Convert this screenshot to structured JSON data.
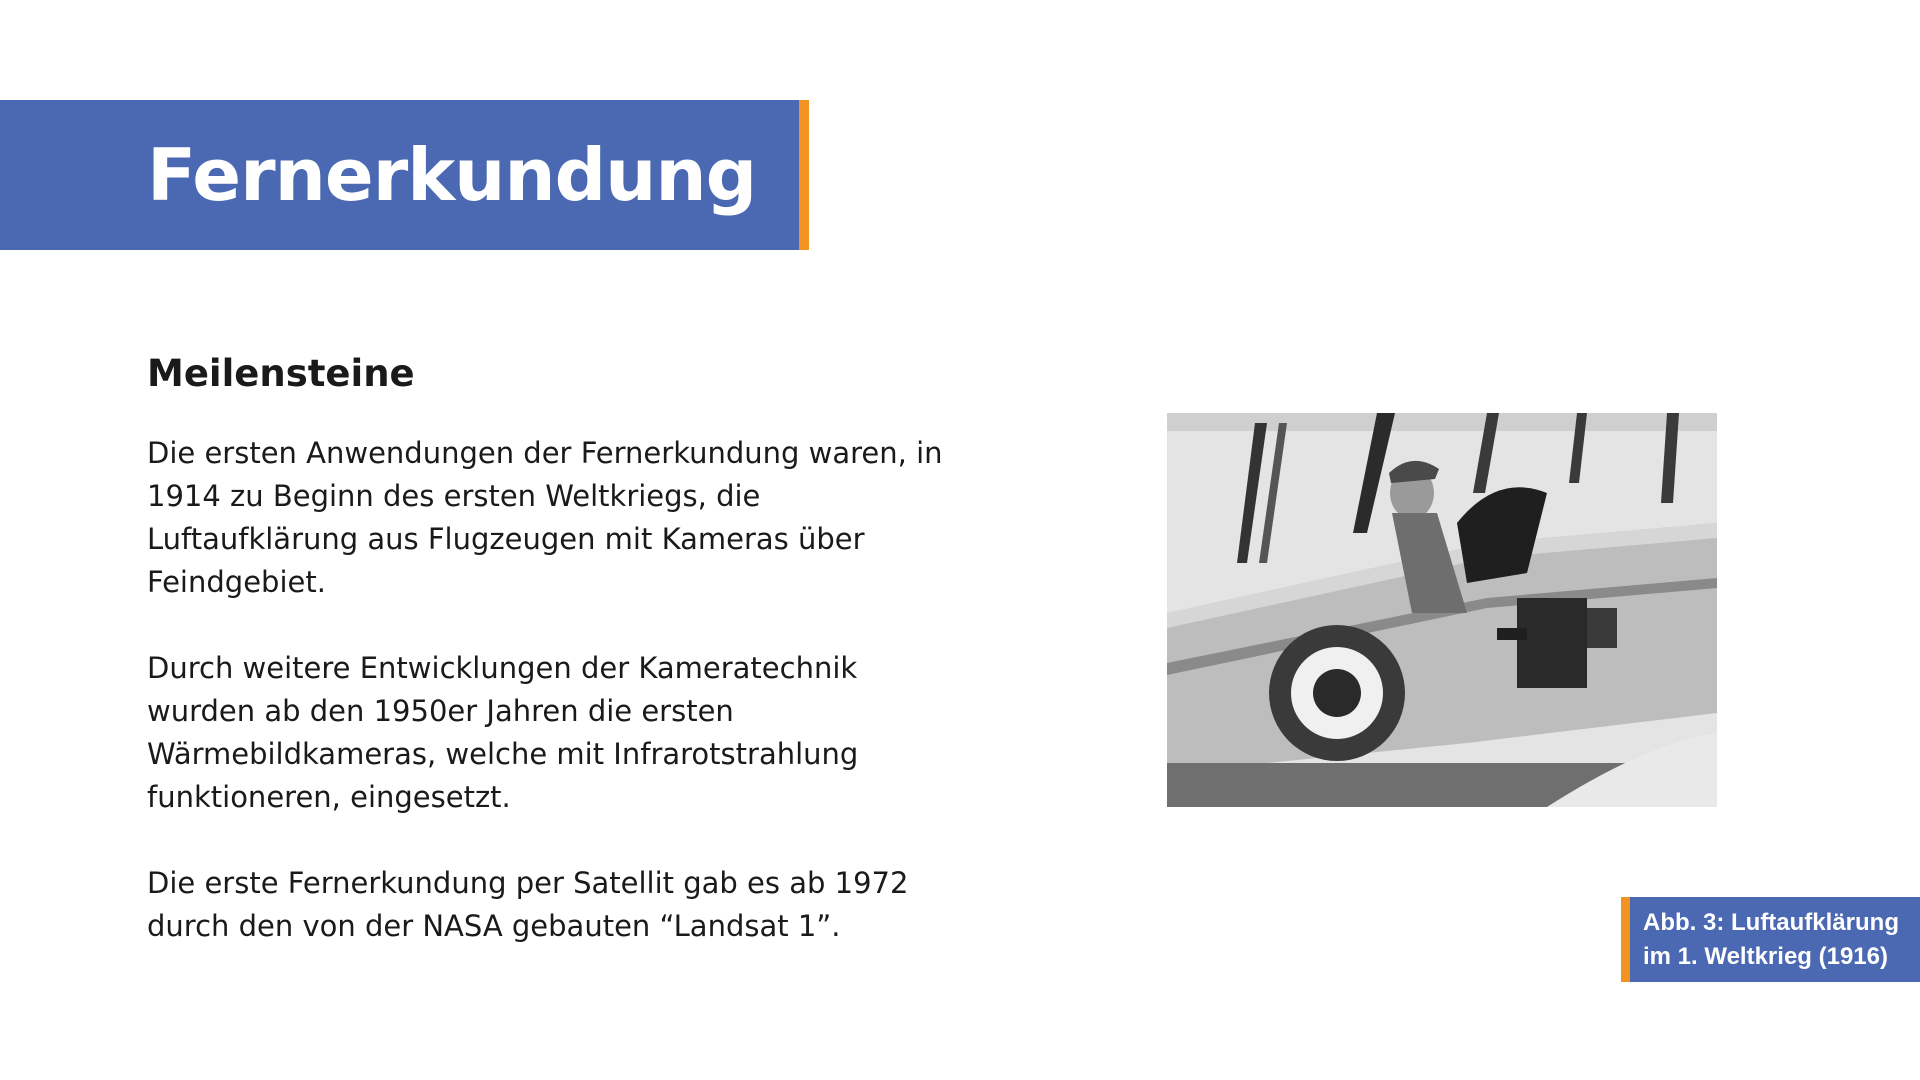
{
  "slide": {
    "title": "Fernerkundung",
    "subheading": "Meilensteine",
    "paragraphs": [
      "Die ersten Anwendungen der Fernerkundung waren, in 1914 zu Beginn des ersten Weltkriegs, die Luftaufklärung aus Flugzeugen mit Kameras über Feindgebiet.",
      "Durch weitere Entwicklungen der Kameratechnik wurden ab den 1950er Jahren die ersten Wärmebildkameras, welche mit Infrarotstrahlung funktioneren, eingesetzt.",
      "Die erste Fernerkundung per Satellit gab es ab 1972 durch den von der NASA gebauten “Landsat 1”."
    ],
    "caption": {
      "line1": "Abb. 3: Luftaufklärung",
      "line2": "im 1. Weltkrieg (1916)"
    },
    "colors": {
      "accent_blue": "#4b69b3",
      "accent_orange": "#f39322",
      "text": "#1a1a1a"
    }
  }
}
